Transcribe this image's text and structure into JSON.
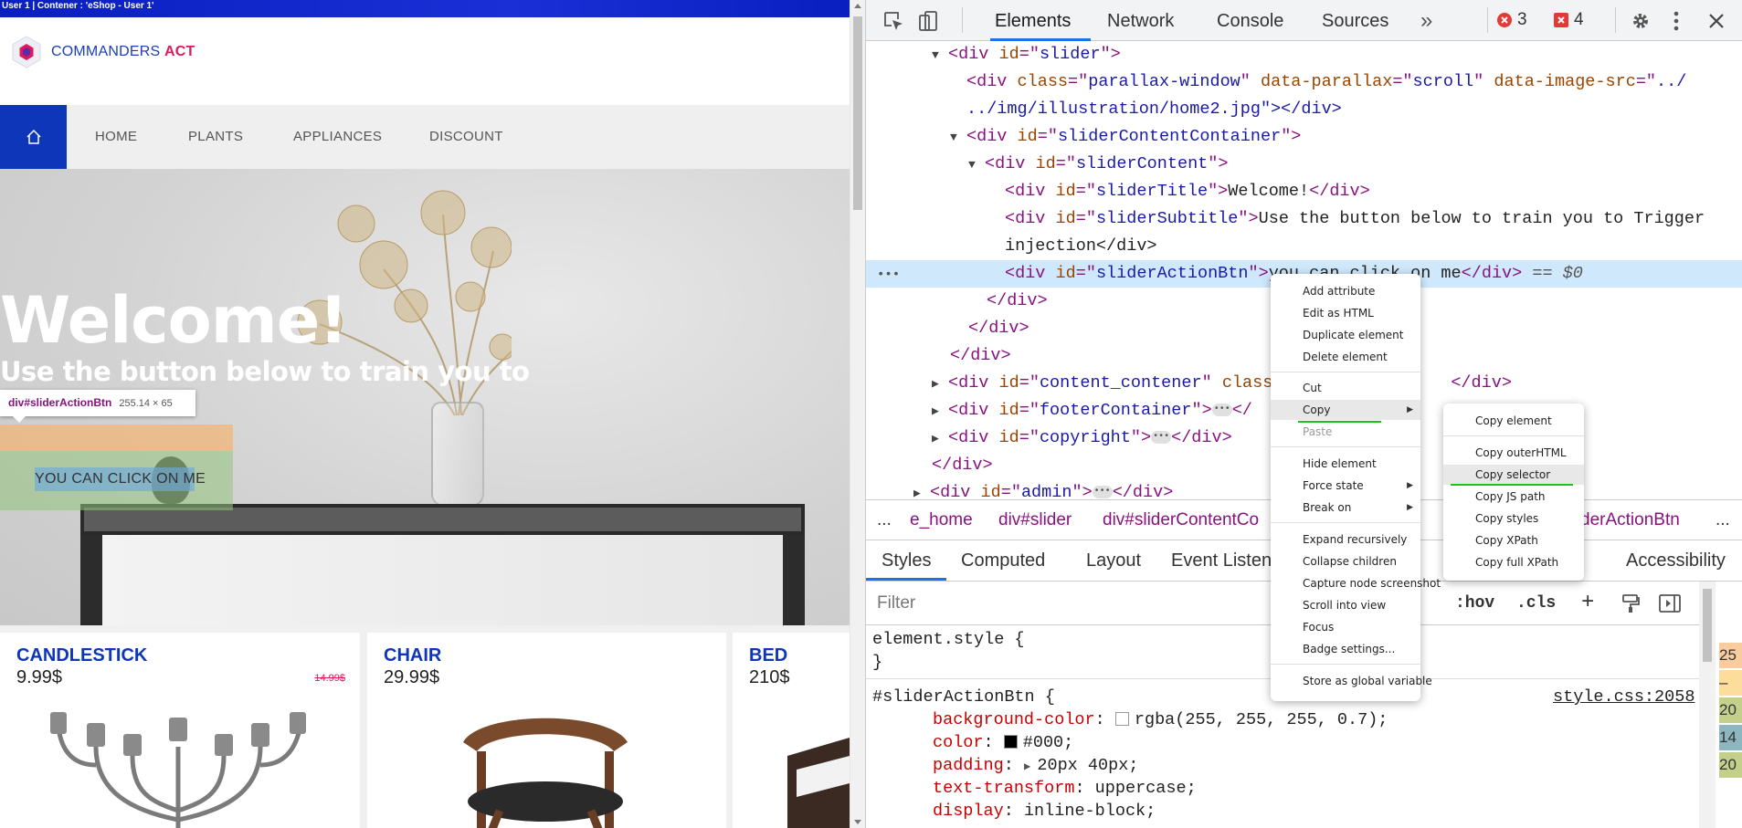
{
  "site": {
    "title_bar": "User 1 | Contener : 'eShop - User 1'",
    "logo": {
      "text": "COMMANDERS",
      "accent": "ACT"
    },
    "nav": [
      "HOME",
      "PLANTS",
      "APPLIANCES",
      "DISCOUNT"
    ],
    "hero": {
      "title": "Welcome!",
      "subtitle": "Use the button below to train you to ... on",
      "button": "YOU CAN CLICK ON ME"
    },
    "inspect_tooltip": {
      "selector": "div#sliderActionBtn",
      "size": "255.14 × 65"
    },
    "products": [
      {
        "name": "CANDLESTICK",
        "price": "9.99$",
        "old_price": "14.99$"
      },
      {
        "name": "CHAIR",
        "price": "29.99$",
        "old_price": ""
      },
      {
        "name": "BED",
        "price": "210$",
        "old_price": ""
      }
    ]
  },
  "devtools": {
    "tabs": [
      "Elements",
      "Network",
      "Console",
      "Sources"
    ],
    "more": "»",
    "errors": "3",
    "warnings": "4",
    "dom": [
      {
        "open": "<div",
        "attrs": [
          [
            "id",
            "slider"
          ]
        ],
        "close": ">"
      },
      {
        "attrs": [
          [
            "class",
            "parallax-window"
          ],
          [
            "data-parallax",
            "scroll"
          ],
          [
            "data-image-src",
            "../"
          ]
        ]
      },
      {
        "text": "../img/illustration/home2.jpg\"></div>"
      },
      {
        "attrs": [
          [
            "id",
            "sliderContentContainer"
          ]
        ]
      },
      {
        "attrs": [
          [
            "id",
            "sliderContent"
          ]
        ]
      },
      {
        "attrs": [
          [
            "id",
            "sliderTitle"
          ]
        ],
        "text": "Welcome!"
      },
      {
        "attrs": [
          [
            "id",
            "sliderSubtitle"
          ]
        ],
        "text": "Use the button below to train you to Trigger"
      },
      {
        "text": "injection</div>"
      },
      {
        "attrs": [
          [
            "id",
            "sliderActionBtn"
          ]
        ],
        "text": "you can click on me",
        "suffix": "== $0"
      },
      {
        "text": "</div>"
      },
      {
        "text": "</div>"
      },
      {
        "text": "</div>"
      },
      {
        "attrs": [
          [
            "id",
            "content_contener"
          ]
        ],
        "text": "class"
      },
      {
        "attrs": [
          [
            "id",
            "footerContainer"
          ]
        ]
      },
      {
        "attrs": [
          [
            "id",
            "copyright"
          ]
        ]
      },
      {
        "text": "</div>"
      },
      {
        "attrs": [
          [
            "id",
            "admin"
          ]
        ]
      }
    ],
    "breadcrumbs": [
      "...",
      "e_home",
      "div#slider",
      "div#sliderContentCo",
      "derActionBtn",
      "..."
    ],
    "subtabs": [
      "Styles",
      "Computed",
      "Layout",
      "Event Listen",
      "es",
      "Accessibility"
    ],
    "filter": {
      "placeholder": "Filter",
      "hov": ":hov",
      "cls": ".cls",
      "plus": "+"
    },
    "styles": {
      "element_style": "element.style {",
      "element_close": "}",
      "rule_selector": "#sliderActionBtn {",
      "rule_source": "style.css:2058",
      "props": [
        {
          "name": "background-color",
          "value": "rgba(255, 255, 255, 0.7);"
        },
        {
          "name": "color",
          "value": "#000;"
        },
        {
          "name": "padding",
          "value": "20px 40px;"
        },
        {
          "name": "text-transform",
          "value": "uppercase;"
        },
        {
          "name": "display",
          "value": "inline-block;"
        }
      ]
    },
    "gutter": [
      "25",
      "–",
      "20",
      "14",
      "20"
    ],
    "context_menu": [
      "Add attribute",
      "Edit as HTML",
      "Duplicate element",
      "Delete element",
      "Cut",
      "Copy",
      "Paste",
      "Hide element",
      "Force state",
      "Break on",
      "Expand recursively",
      "Collapse children",
      "Capture node screenshot",
      "Scroll into view",
      "Focus",
      "Badge settings...",
      "Store as global variable"
    ],
    "copy_submenu": [
      "Copy element",
      "Copy outerHTML",
      "Copy selector",
      "Copy JS path",
      "Copy styles",
      "Copy XPath",
      "Copy full XPath"
    ]
  },
  "colors": {
    "brand_blue": "#0e36b8",
    "accent_pink": "#e0195b",
    "selection": "#cfe8fc",
    "highlight_green": "#1fbf24"
  }
}
